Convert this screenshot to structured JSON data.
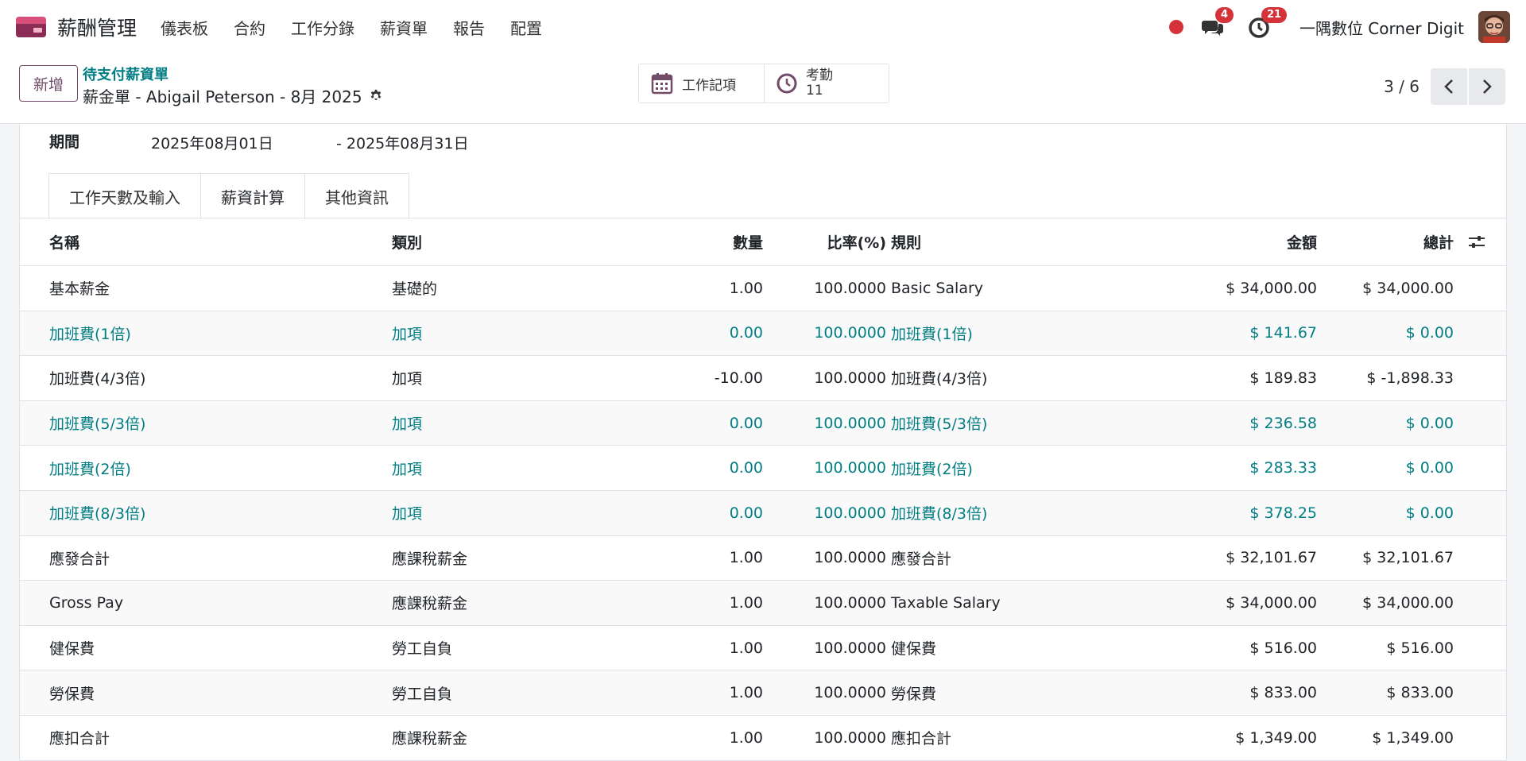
{
  "navbar": {
    "app_name": "薪酬管理",
    "menu": [
      "儀表板",
      "合約",
      "工作分錄",
      "薪資單",
      "報告",
      "配置"
    ],
    "messages_badge": "4",
    "activities_badge": "21",
    "company": "一隅數位 Corner Digit"
  },
  "control": {
    "new_label": "新增",
    "breadcrumb": "待支付薪資單",
    "record_title": "薪金單 - Abigail Peterson - 8月 2025",
    "smart_work_entries": "工作記項",
    "smart_attendance_label": "考勤",
    "smart_attendance_value": "11",
    "pager": "3 / 6"
  },
  "form": {
    "period_label": "期間",
    "period_from": "2025年08月01日",
    "period_to": "- 2025年08月31日",
    "tabs": [
      "工作天數及輸入",
      "薪資計算",
      "其他資訊"
    ]
  },
  "table": {
    "headers": {
      "name": "名稱",
      "category": "類別",
      "quantity": "數量",
      "rate": "比率(%)",
      "rule": "規則",
      "amount": "金額",
      "total": "總計"
    },
    "rows": [
      {
        "name": "基本薪金",
        "category": "基礎的",
        "quantity": "1.00",
        "rate": "100.0000",
        "rule": "Basic Salary",
        "amount": "$ 34,000.00",
        "total": "$ 34,000.00"
      },
      {
        "name": "加班費(1倍)",
        "category": "加項",
        "quantity": "0.00",
        "rate": "100.0000",
        "rule": "加班費(1倍)",
        "amount": "$ 141.67",
        "total": "$ 0.00"
      },
      {
        "name": "加班費(4/3倍)",
        "category": "加項",
        "quantity": "-10.00",
        "rate": "100.0000",
        "rule": "加班費(4/3倍)",
        "amount": "$ 189.83",
        "total": "$ -1,898.33"
      },
      {
        "name": "加班費(5/3倍)",
        "category": "加項",
        "quantity": "0.00",
        "rate": "100.0000",
        "rule": "加班費(5/3倍)",
        "amount": "$ 236.58",
        "total": "$ 0.00"
      },
      {
        "name": "加班費(2倍)",
        "category": "加項",
        "quantity": "0.00",
        "rate": "100.0000",
        "rule": "加班費(2倍)",
        "amount": "$ 283.33",
        "total": "$ 0.00"
      },
      {
        "name": "加班費(8/3倍)",
        "category": "加項",
        "quantity": "0.00",
        "rate": "100.0000",
        "rule": "加班費(8/3倍)",
        "amount": "$ 378.25",
        "total": "$ 0.00"
      },
      {
        "name": "應發合計",
        "category": "應課稅薪金",
        "quantity": "1.00",
        "rate": "100.0000",
        "rule": "應發合計",
        "amount": "$ 32,101.67",
        "total": "$ 32,101.67"
      },
      {
        "name": "Gross Pay",
        "category": "應課稅薪金",
        "quantity": "1.00",
        "rate": "100.0000",
        "rule": "Taxable Salary",
        "amount": "$ 34,000.00",
        "total": "$ 34,000.00"
      },
      {
        "name": "健保費",
        "category": "勞工自負",
        "quantity": "1.00",
        "rate": "100.0000",
        "rule": "健保費",
        "amount": "$ 516.00",
        "total": "$ 516.00"
      },
      {
        "name": "勞保費",
        "category": "勞工自負",
        "quantity": "1.00",
        "rate": "100.0000",
        "rule": "勞保費",
        "amount": "$ 833.00",
        "total": "$ 833.00"
      },
      {
        "name": "應扣合計",
        "category": "應課稅薪金",
        "quantity": "1.00",
        "rate": "100.0000",
        "rule": "應扣合計",
        "amount": "$ 1,349.00",
        "total": "$ 1,349.00"
      }
    ]
  },
  "colors": {
    "link": "#017e84",
    "brand": "#714b67",
    "badge": "#d5323a"
  }
}
